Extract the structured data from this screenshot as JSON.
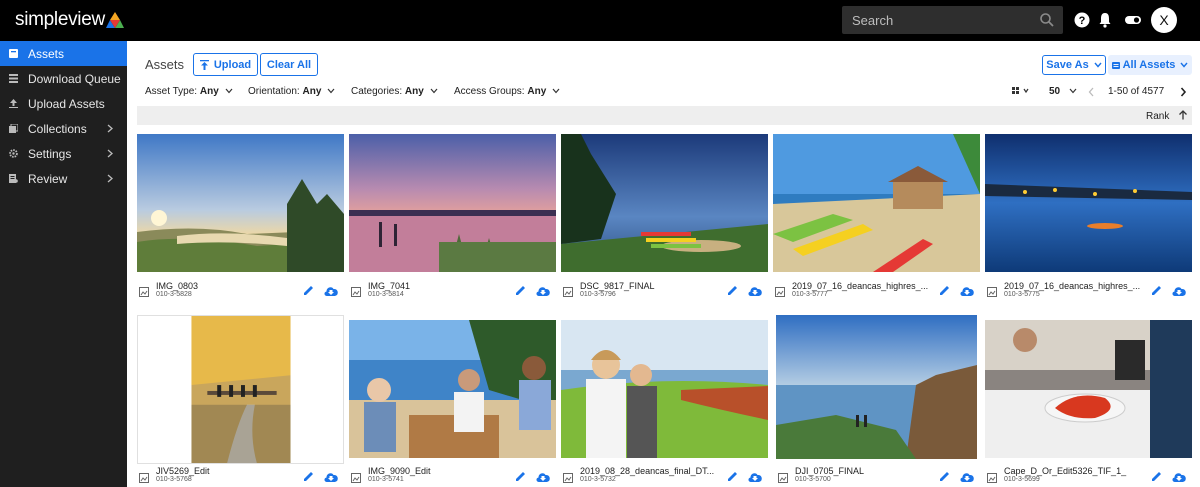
{
  "app": {
    "logo_text": "simpleview"
  },
  "header": {
    "search_placeholder": "Search",
    "avatar_initial": "X"
  },
  "sidebar": {
    "items": [
      {
        "label": "Assets",
        "active": true
      },
      {
        "label": "Download Queue"
      },
      {
        "label": "Upload Assets"
      },
      {
        "label": "Collections",
        "has_children": true
      },
      {
        "label": "Settings",
        "has_children": true
      },
      {
        "label": "Review",
        "has_children": true
      }
    ]
  },
  "main": {
    "title": "Assets",
    "upload_label": "Upload",
    "clear_label": "Clear All",
    "save_as_label": "Save As",
    "all_assets_label": "All Assets",
    "filters": [
      {
        "label": "Asset Type:",
        "value": "Any"
      },
      {
        "label": "Orientation:",
        "value": "Any"
      },
      {
        "label": "Categories:",
        "value": "Any"
      },
      {
        "label": "Access Groups:",
        "value": "Any"
      }
    ],
    "page_size": "50",
    "range": "1-50 of 4577",
    "sort_label": "Rank"
  },
  "assets": [
    {
      "name": "IMG_0803",
      "id": "010-3-5828"
    },
    {
      "name": "IMG_7041",
      "id": "010-3-5814"
    },
    {
      "name": "DSC_9817_FINAL",
      "id": "010-3-5796"
    },
    {
      "name": "2019_07_16_deancas_highres_...",
      "id": "010-3-5777"
    },
    {
      "name": "2019_07_16_deancas_highres_...",
      "id": "010-3-5775"
    },
    {
      "name": "JIV5269_Edit",
      "id": "010-3-5768"
    },
    {
      "name": "IMG_9090_Edit",
      "id": "010-3-5741"
    },
    {
      "name": "2019_08_28_deancas_final_DT...",
      "id": "010-3-5732"
    },
    {
      "name": "DJI_0705_FINAL",
      "id": "010-3-5700"
    },
    {
      "name": "Cape_D_Or_Edit5326_TIF_1_",
      "id": "010-3-5699"
    }
  ],
  "colors": {
    "accent": "#1a73e8",
    "topbar": "#000000",
    "sidebar": "#1f1f1f"
  }
}
